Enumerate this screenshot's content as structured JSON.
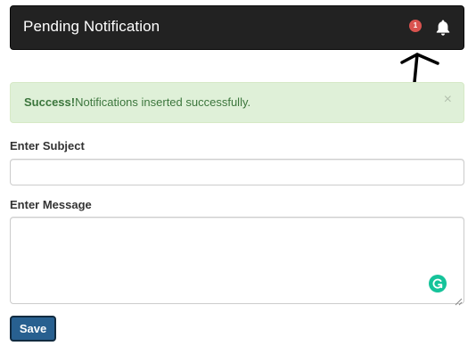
{
  "navbar": {
    "title": "Pending Notification",
    "badge_count": "1",
    "bell_icon": "bell-icon",
    "badge_color": "#d9534f",
    "background": "#222222"
  },
  "alert": {
    "strong": "Success!",
    "message": "Notifications inserted successfully.",
    "close_label": "×",
    "background": "#dff0d8",
    "text_color": "#3c763d"
  },
  "form": {
    "subject_label": "Enter Subject",
    "subject_value": "",
    "message_label": "Enter Message",
    "message_value": "",
    "save_label": "Save",
    "save_color": "#286090"
  },
  "icons": {
    "annotation": "arrow-up-icon",
    "grammarly": "grammarly-icon",
    "resize": "resize-grip-icon"
  }
}
